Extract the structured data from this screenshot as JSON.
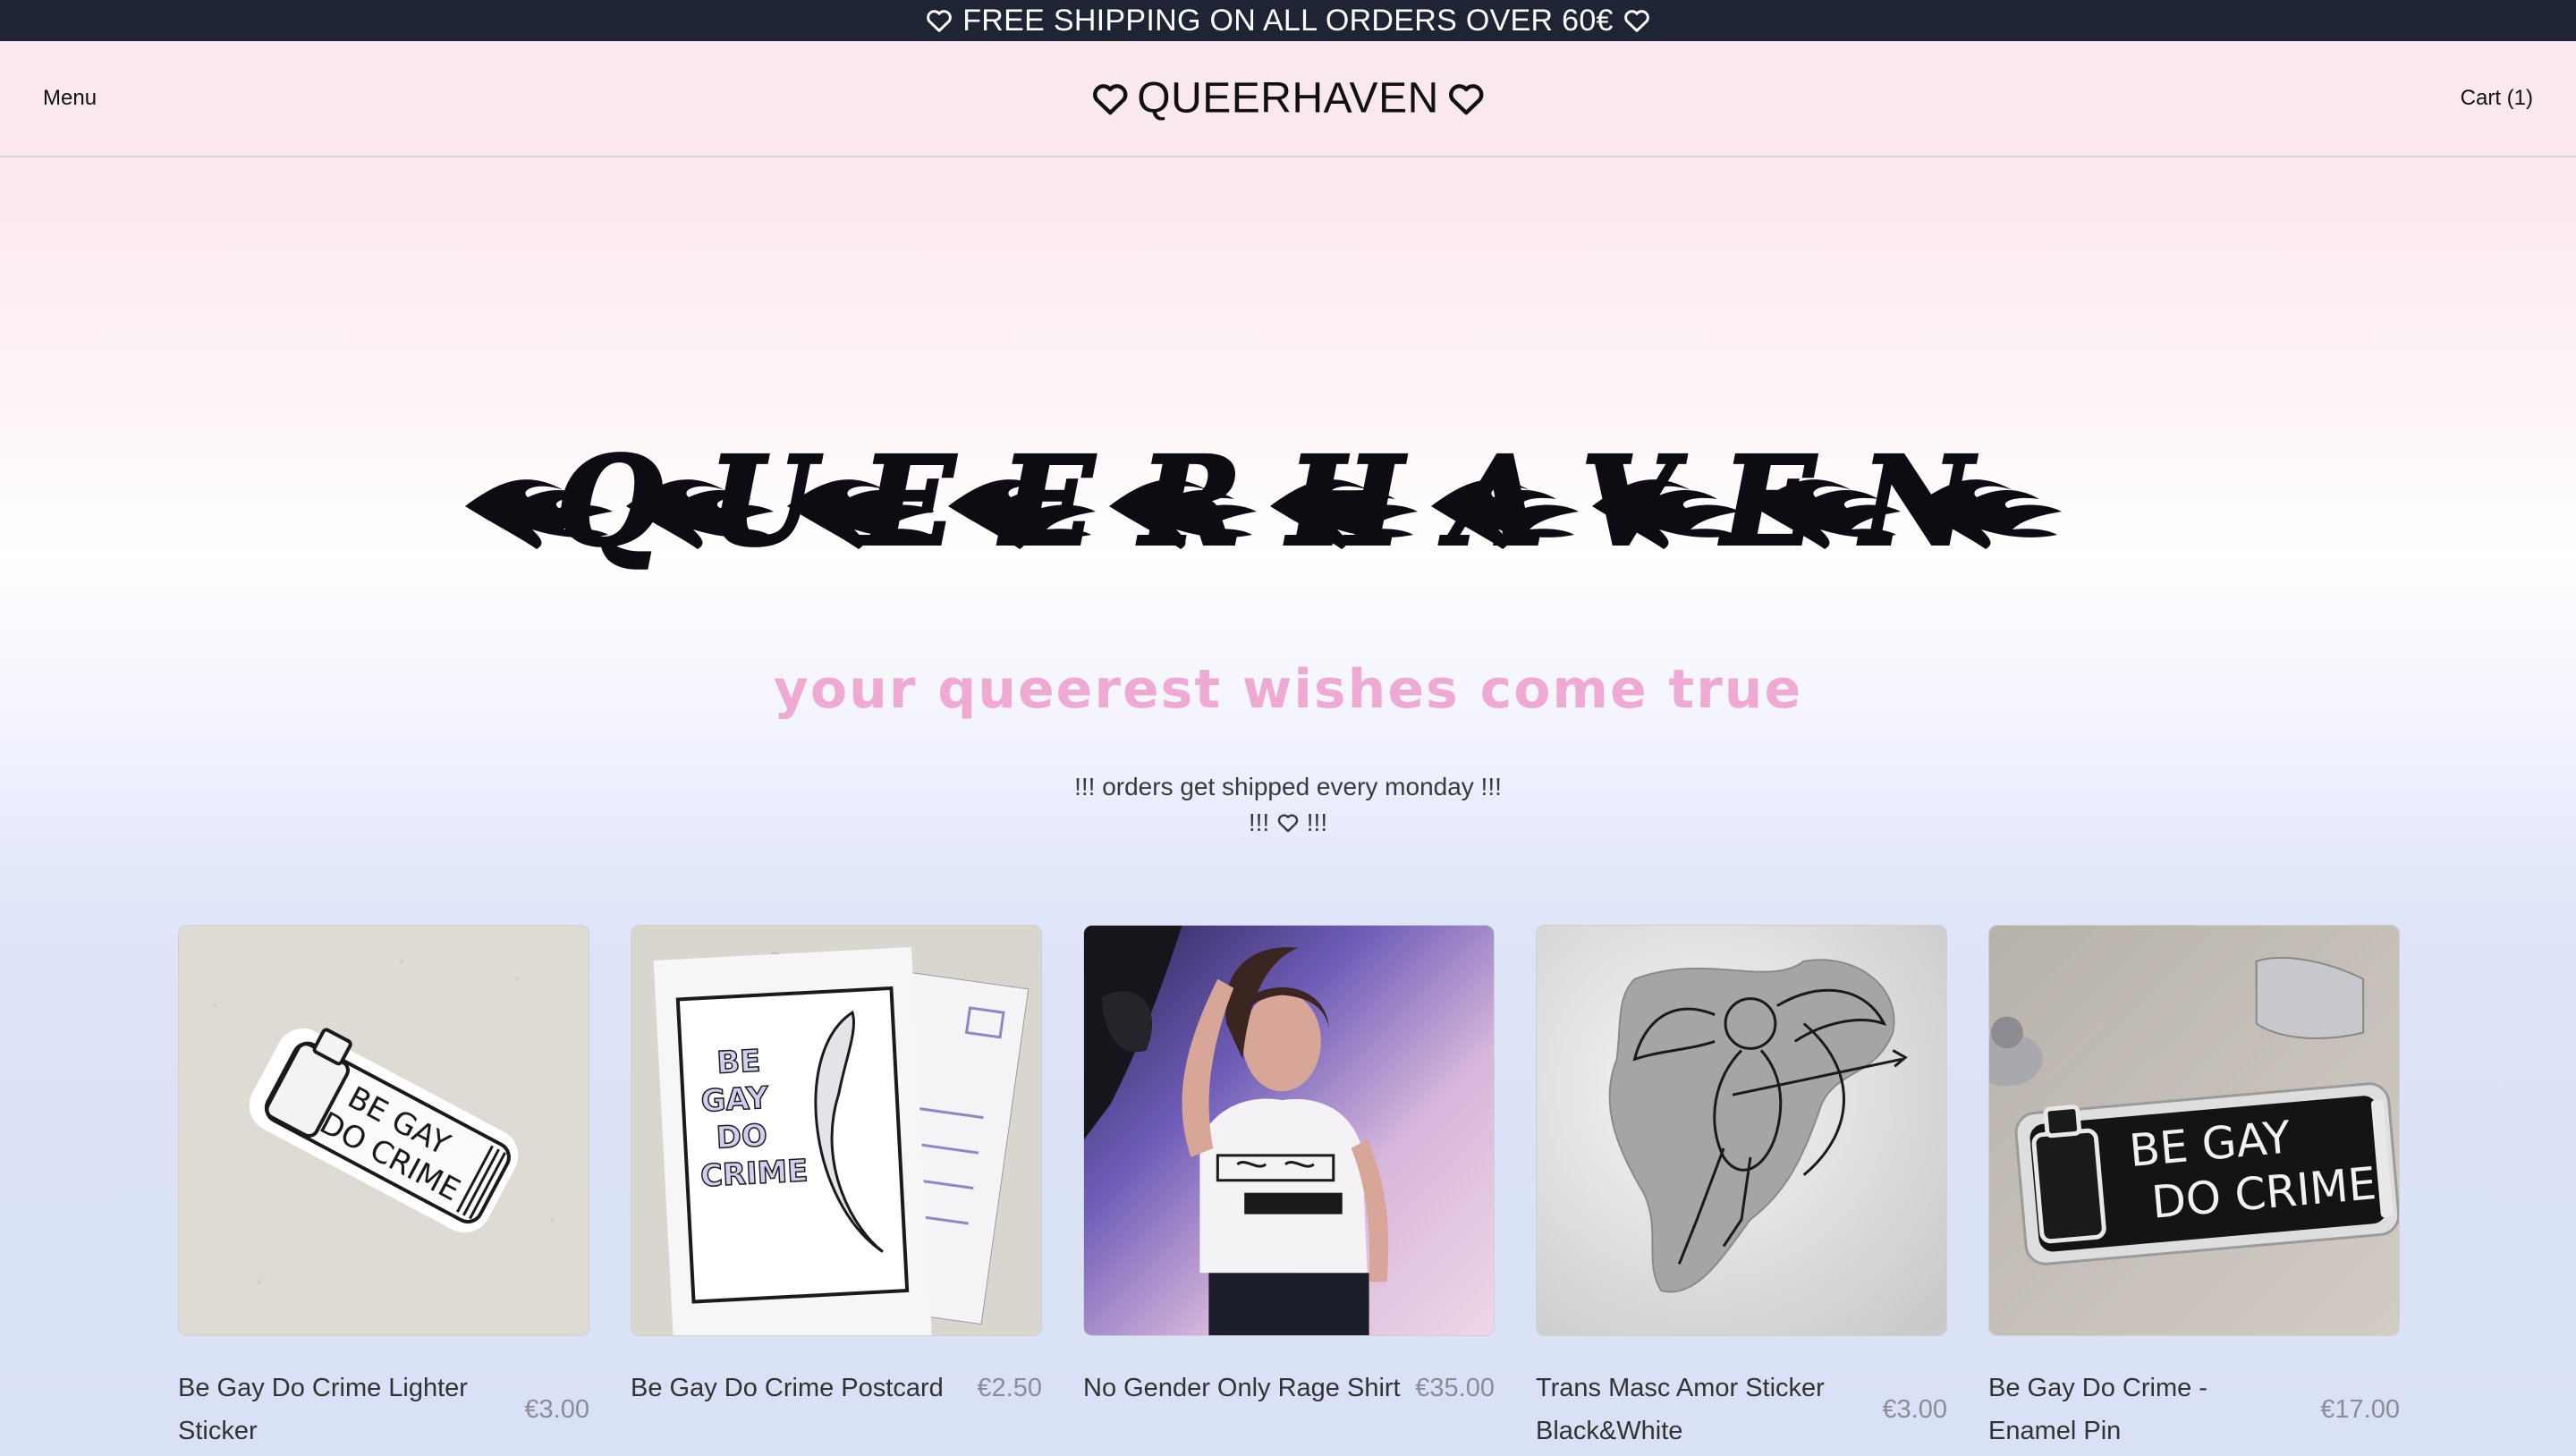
{
  "announcement": {
    "text": "FREE SHIPPING ON ALL ORDERS OVER 60€",
    "icon": "heart-outline-icon"
  },
  "header": {
    "menu_label": "Menu",
    "logo_text": "QUEERHAVEN",
    "cart_label": "Cart (1)"
  },
  "hero": {
    "title": "QUEERHAVEN",
    "tagline": "your queerest wishes come true",
    "notice_line1": "!!! orders get shipped every monday !!!",
    "notice_line2_left": "!!!",
    "notice_line2_right": "!!!"
  },
  "products": [
    {
      "name": "Be Gay Do Crime Lighter Sticker",
      "price": "€3.00",
      "image_text": "BE GAY DO CRIME"
    },
    {
      "name": "Be Gay Do Crime Postcard",
      "price": "€2.50",
      "image_text": "BE GAY DO CRIME"
    },
    {
      "name": "No Gender Only Rage Shirt",
      "price": "€35.00"
    },
    {
      "name": "Trans Masc Amor Sticker Black&White",
      "price": "€3.00"
    },
    {
      "name": "Be Gay Do Crime - Enamel Pin",
      "price": "€17.00",
      "image_text": "BE GAY DO CRIME"
    }
  ],
  "colors": {
    "announcement_bg": "#1e2433",
    "tagline": "#eeaad2",
    "header_bg": "#fae8f1"
  }
}
